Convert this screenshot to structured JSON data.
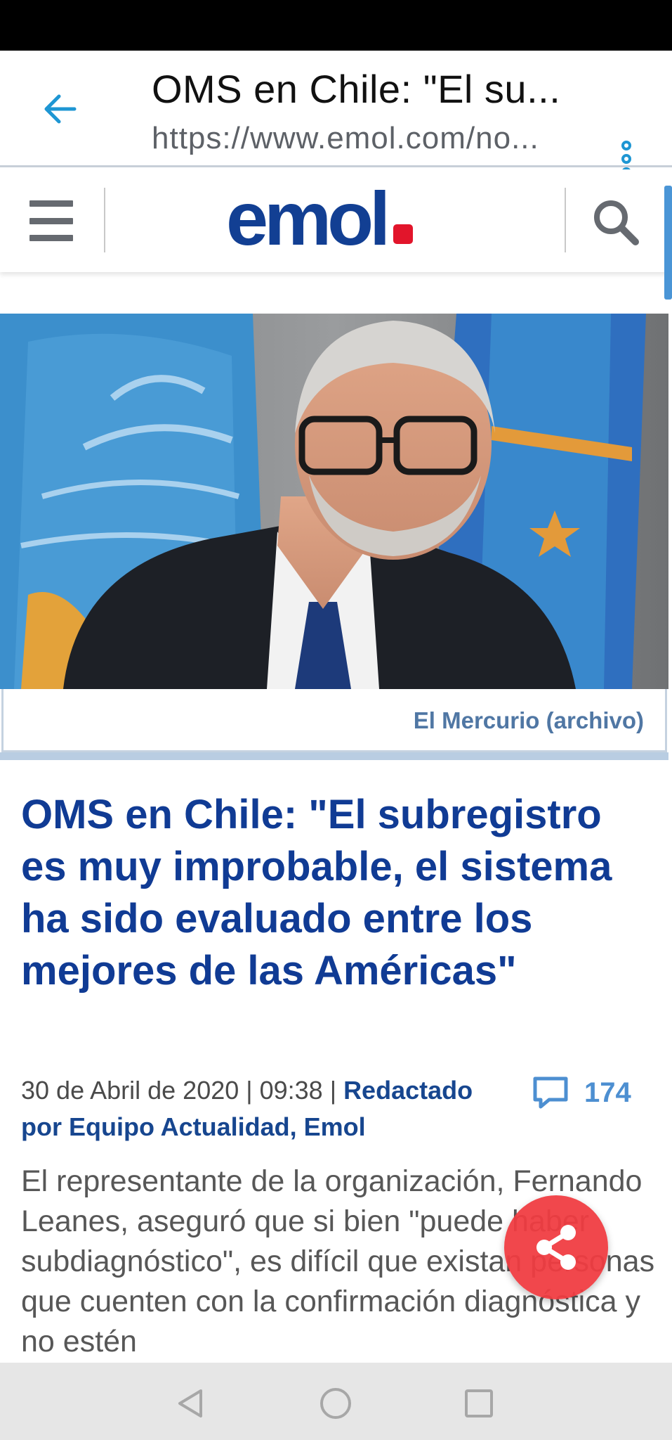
{
  "browser": {
    "title": "OMS en Chile: \"El su...",
    "url": "https://www.emol.com/no..."
  },
  "site": {
    "logo_text": "emol",
    "logo_color": "#123f93",
    "logo_dot_color": "#e2152b"
  },
  "icons": {
    "back": "arrow-left-icon",
    "menu": "three-dot-vertical-icon",
    "hamburger": "hamburger-menu-icon",
    "search": "magnifier-icon",
    "comments": "speech-bubble-icon",
    "share": "share-icon"
  },
  "article": {
    "image_caption": "El Mercurio (archivo)",
    "headline": "OMS en Chile: \"El subregistro es muy improbable, el sistema ha sido evaluado entre los mejores de las Américas\"",
    "date": "30 de Abril de 2020 | 09:38 | ",
    "author": "Redactado por Equipo Actualidad, Emol",
    "comments_count": "174",
    "lead": "El representante de la organización, Fernando Leanes, aseguró que si bien \"puede haber subdiagnóstico\", es difícil que existan personas que cuenten con la confirmación diagnóstica y no estén"
  },
  "navbar": {
    "back": "triangle-back-icon",
    "home": "circle-home-icon",
    "recents": "square-recents-icon"
  },
  "colors": {
    "accent": "#1e96d3",
    "headline": "#103b94",
    "share_fab": "#f03c41"
  }
}
